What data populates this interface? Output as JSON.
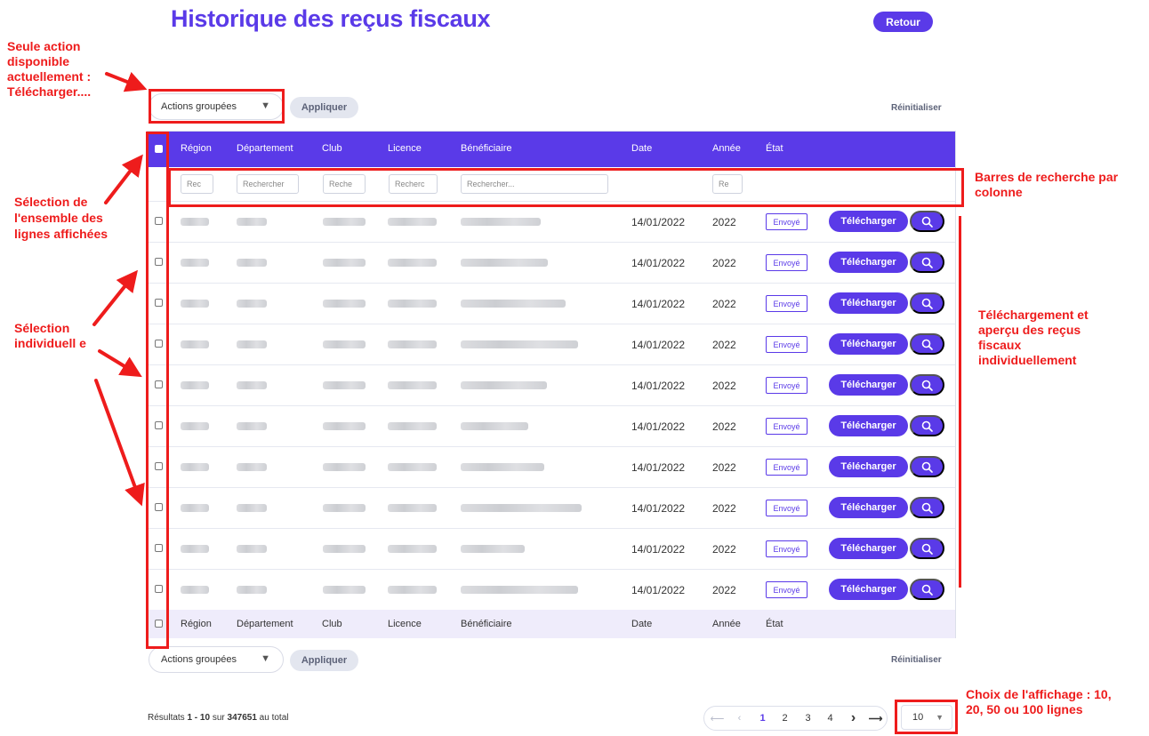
{
  "page": {
    "title": "Historique des reçus fiscaux",
    "back_label": "Retour"
  },
  "toolbar_top": {
    "bulk_actions": "Actions groupées",
    "apply": "Appliquer",
    "reset": "Réinitialiser"
  },
  "toolbar_bottom": {
    "bulk_actions": "Actions groupées",
    "apply": "Appliquer",
    "reset": "Réinitialiser"
  },
  "table": {
    "columns": [
      "Région",
      "Département",
      "Club",
      "Licence",
      "Bénéficiaire",
      "Date",
      "Année",
      "État"
    ],
    "filters": {
      "region": "Rec",
      "departement": "Rechercher",
      "club": "Reche",
      "licence": "Recherc",
      "beneficiaire": "Rechercher...",
      "annee": "Re"
    },
    "rows": [
      {
        "date": "14/01/2022",
        "annee": "2022",
        "etat": "Envoyé",
        "download": "Télécharger"
      },
      {
        "date": "14/01/2022",
        "annee": "2022",
        "etat": "Envoyé",
        "download": "Télécharger"
      },
      {
        "date": "14/01/2022",
        "annee": "2022",
        "etat": "Envoyé",
        "download": "Télécharger"
      },
      {
        "date": "14/01/2022",
        "annee": "2022",
        "etat": "Envoyé",
        "download": "Télécharger"
      },
      {
        "date": "14/01/2022",
        "annee": "2022",
        "etat": "Envoyé",
        "download": "Télécharger"
      },
      {
        "date": "14/01/2022",
        "annee": "2022",
        "etat": "Envoyé",
        "download": "Télécharger"
      },
      {
        "date": "14/01/2022",
        "annee": "2022",
        "etat": "Envoyé",
        "download": "Télécharger"
      },
      {
        "date": "14/01/2022",
        "annee": "2022",
        "etat": "Envoyé",
        "download": "Télécharger"
      },
      {
        "date": "14/01/2022",
        "annee": "2022",
        "etat": "Envoyé",
        "download": "Télécharger"
      },
      {
        "date": "14/01/2022",
        "annee": "2022",
        "etat": "Envoyé",
        "download": "Télécharger"
      }
    ]
  },
  "footer": {
    "results_prefix": "Résultats",
    "results_range": "1 - 10",
    "results_mid": "sur",
    "results_total": "347651",
    "results_suffix": "au total",
    "pages": [
      "1",
      "2",
      "3",
      "4"
    ],
    "page_size": "10"
  },
  "annotations": {
    "bulk": "Seule action disponible actuellement : Télécharger....",
    "select_all": "Sélection de l'ensemble des lignes affichées",
    "select_individual": "Sélection individuell e",
    "search_bars": "Barres de recherche par colonne",
    "download": "Téléchargement et aperçu des reçus fiscaux individuellement",
    "page_size": "Choix de l'affichage : 10, 20, 50 ou 100 lignes"
  },
  "colors": {
    "accent": "#5a3ae8",
    "annotation": "#ee1c1c",
    "footer_row": "#efecfb"
  },
  "icons": [
    "search-icon",
    "caret-down-icon",
    "arrow-left-icon",
    "chevron-left-icon",
    "chevron-right-icon",
    "arrow-right-icon"
  ]
}
